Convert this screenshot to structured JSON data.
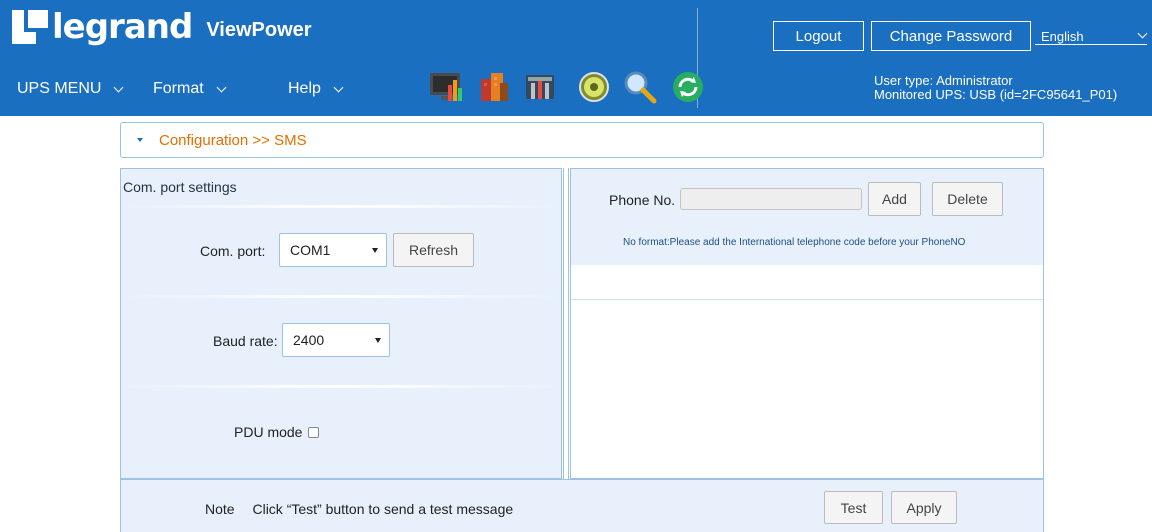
{
  "header": {
    "brand": "legrand",
    "product": "ViewPower",
    "menus": [
      {
        "label": "UPS MENU"
      },
      {
        "label": "Format"
      },
      {
        "label": "Help"
      }
    ],
    "toolbar_icons": [
      "monitor-chart-icon",
      "buildings-icon",
      "tools-icon",
      "disk-icon",
      "magnifier-icon",
      "refresh-icon"
    ],
    "logout_label": "Logout",
    "change_password_label": "Change Password",
    "language": "English",
    "user_type": "User type: Administrator",
    "monitored_ups": "Monitored UPS: USB (id=2FC95641_P01)"
  },
  "breadcrumb": "Configuration >> SMS",
  "com_settings": {
    "title": "Com. port settings",
    "com_port_label": "Com. port:",
    "com_port_value": "COM1",
    "refresh_label": "Refresh",
    "baud_rate_label": "Baud rate:",
    "baud_rate_value": "2400",
    "pdu_mode_label": "PDU mode",
    "pdu_mode_checked": false
  },
  "phone": {
    "label": "Phone No.",
    "value": "",
    "add_label": "Add",
    "delete_label": "Delete",
    "hint": "No format:Please add the International telephone code before your PhoneNO",
    "numbers": []
  },
  "footer": {
    "note_label": "Note",
    "note_text": "Click “Test” button to send a test message",
    "test_label": "Test",
    "apply_label": "Apply"
  },
  "colors": {
    "header_bg": "#1a6fc0",
    "crumb_text": "#e07000",
    "panel_bg": "#e8f1fb",
    "panel_border": "#9cc3e6"
  }
}
